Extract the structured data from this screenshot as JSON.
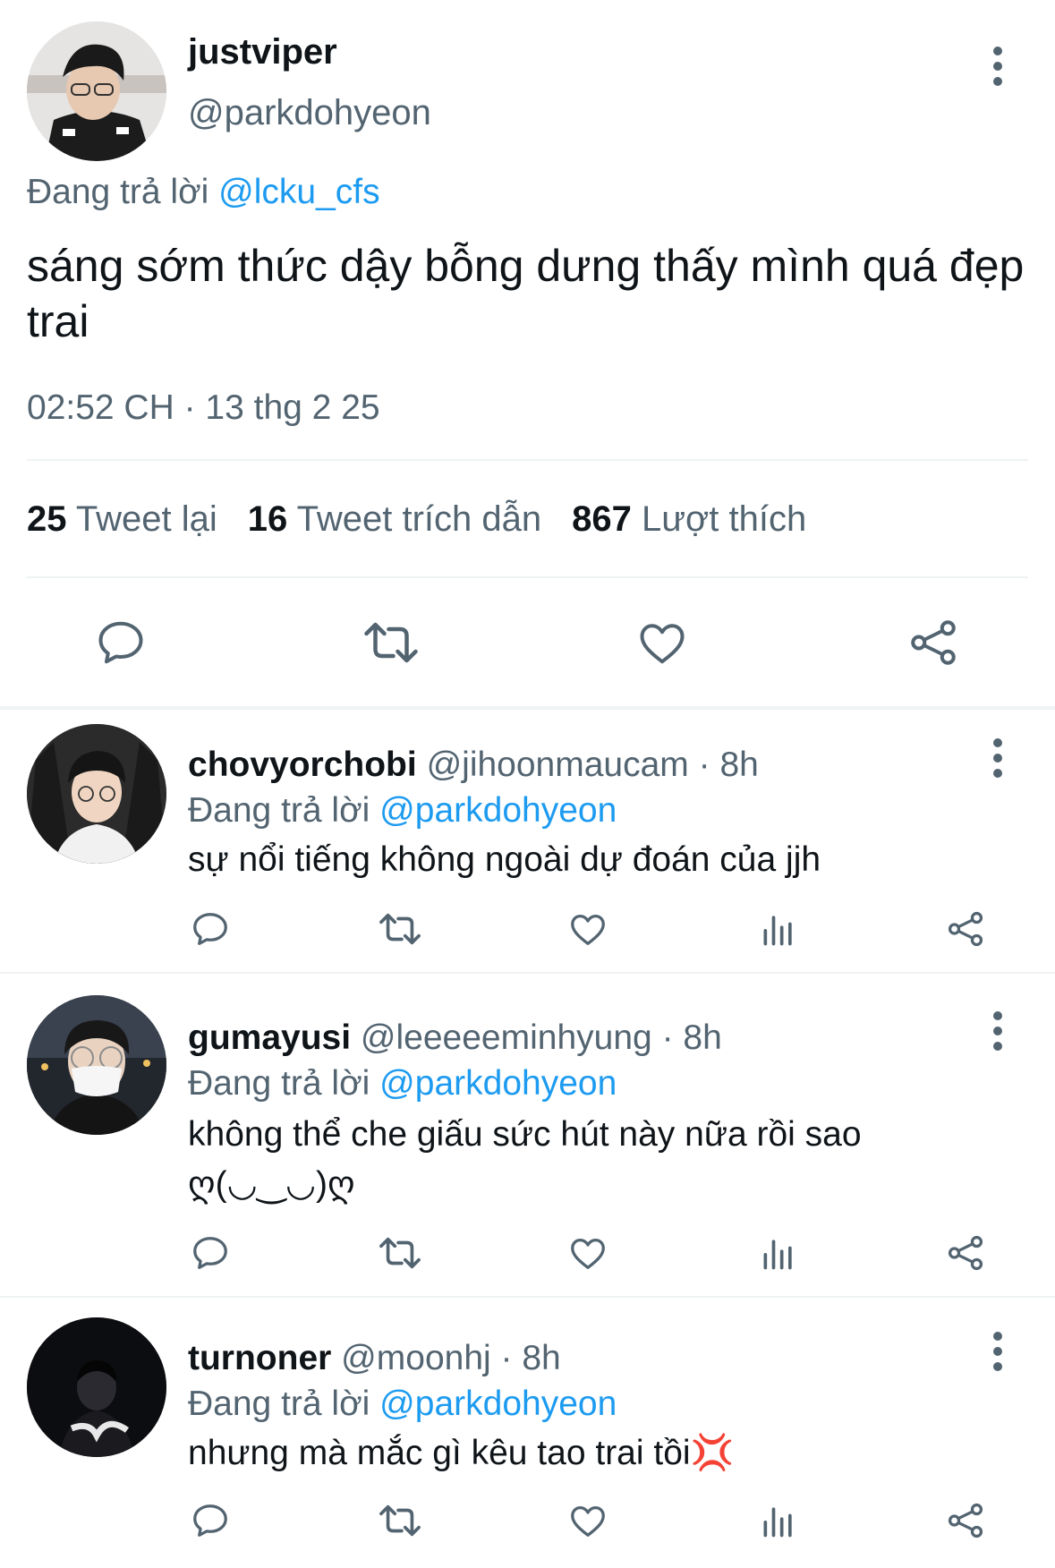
{
  "main_tweet": {
    "display_name": "justviper",
    "handle": "@parkdohyeon",
    "replying_prefix": "Đang trả lời",
    "replying_to": "@lcku_cfs",
    "text": "sáng sớm thức dậy bỗng dưng thấy mình quá đẹp trai",
    "timestamp": "02:52 CH · 13 thg 2 25",
    "stats": {
      "retweets_count": "25",
      "retweets_label": "Tweet lại",
      "quotes_count": "16",
      "quotes_label": "Tweet trích dẫn",
      "likes_count": "867",
      "likes_label": "Lượt thích"
    },
    "actions": [
      "reply-icon",
      "retweet-icon",
      "like-icon",
      "share-icon"
    ]
  },
  "replies": [
    {
      "display_name": "chovyorchobi",
      "handle": "@jihoonmaucam",
      "time": "· 8h",
      "replying_prefix": "Đang trả lời",
      "replying_to": "@parkdohyeon",
      "text": "sự nổi tiếng không ngoài dự đoán của jjh"
    },
    {
      "display_name": "gumayusi",
      "handle": "@leeeeeminhyung",
      "time": "· 8h",
      "replying_prefix": "Đang trả lời",
      "replying_to": "@parkdohyeon",
      "text": "không thể che giấu sức hút này nữa rồi sao\nღ(◡‿◡)ღ"
    },
    {
      "display_name": "turnoner",
      "handle": "@moonhj",
      "time": "· 8h",
      "replying_prefix": "Đang trả lời",
      "replying_to": "@parkdohyeon",
      "text": "nhưng mà mắc gì kêu tao trai tồi💢"
    }
  ],
  "reply_actions": [
    "reply-icon",
    "retweet-icon",
    "like-icon",
    "analytics-icon",
    "share-icon"
  ],
  "colors": {
    "text_primary": "#0f1419",
    "text_secondary": "#536471",
    "link": "#1d9bf0",
    "divider": "#eff3f4",
    "anger_symbol": "#f4511e"
  }
}
